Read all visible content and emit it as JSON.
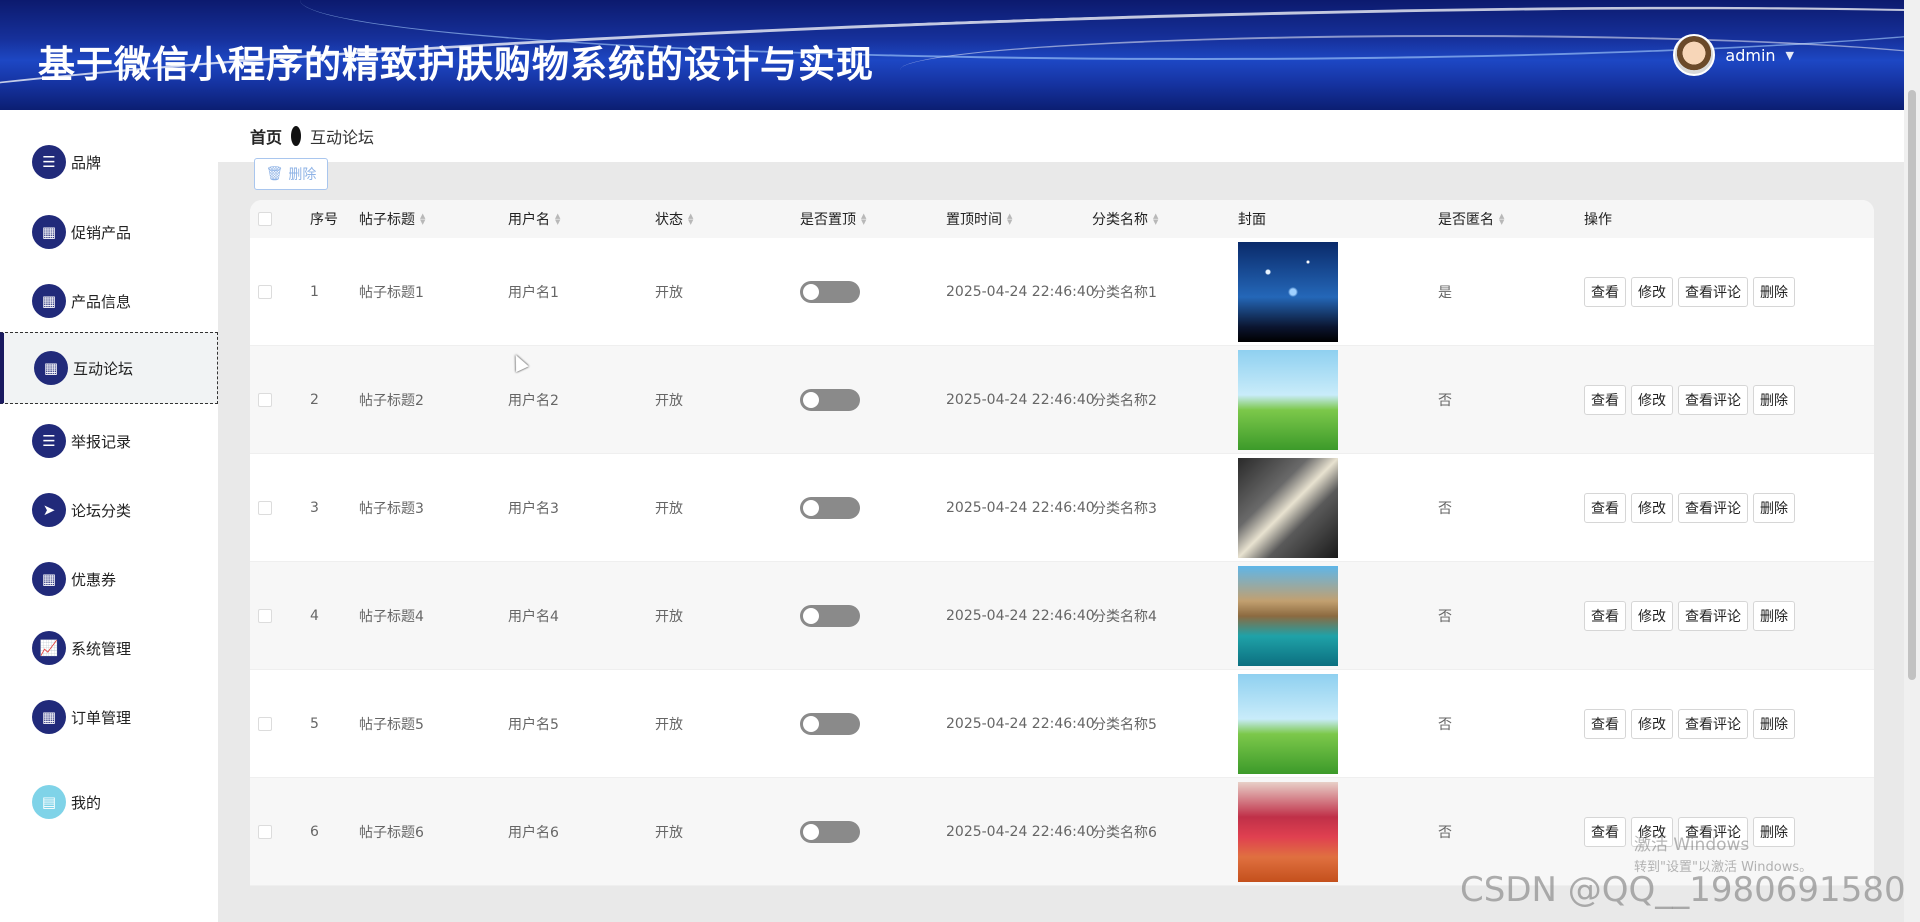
{
  "header": {
    "title": "基于微信小程序的精致护肤购物系统的设计与实现",
    "username": "admin"
  },
  "sidebar": {
    "items": [
      {
        "label": "品牌",
        "icon": "list-icon"
      },
      {
        "label": "促销产品",
        "icon": "grid-icon"
      },
      {
        "label": "产品信息",
        "icon": "grid-icon"
      },
      {
        "label": "互动论坛",
        "icon": "grid-icon"
      },
      {
        "label": "举报记录",
        "icon": "list-icon"
      },
      {
        "label": "论坛分类",
        "icon": "send-icon"
      },
      {
        "label": "优惠券",
        "icon": "grid-icon"
      },
      {
        "label": "系统管理",
        "icon": "chart-icon"
      },
      {
        "label": "订单管理",
        "icon": "grid-icon"
      },
      {
        "label": "我的",
        "icon": "card-icon"
      }
    ],
    "active_index": 3
  },
  "breadcrumb": {
    "home": "首页",
    "current": "互动论坛"
  },
  "toolbar": {
    "delete_label": "删除"
  },
  "table": {
    "headers": {
      "index": "序号",
      "title": "帖子标题",
      "username": "用户名",
      "status": "状态",
      "pinned": "是否置顶",
      "pin_time": "置顶时间",
      "category": "分类名称",
      "cover": "封面",
      "anonymous": "是否匿名",
      "actions": "操作"
    },
    "action_labels": {
      "view": "查看",
      "edit": "修改",
      "comments": "查看评论",
      "delete": "删除"
    },
    "rows": [
      {
        "index": "1",
        "title": "帖子标题1",
        "username": "用户名1",
        "status": "开放",
        "pin_time": "2025-04-24 22:46:40",
        "category": "分类名称1",
        "anonymous": "是",
        "cover": "starry-night"
      },
      {
        "index": "2",
        "title": "帖子标题2",
        "username": "用户名2",
        "status": "开放",
        "pin_time": "2025-04-24 22:46:40",
        "category": "分类名称2",
        "anonymous": "否",
        "cover": "green-field"
      },
      {
        "index": "3",
        "title": "帖子标题3",
        "username": "用户名3",
        "status": "开放",
        "pin_time": "2025-04-24 22:46:40",
        "category": "分类名称3",
        "anonymous": "否",
        "cover": "open-book"
      },
      {
        "index": "4",
        "title": "帖子标题4",
        "username": "用户名4",
        "status": "开放",
        "pin_time": "2025-04-24 22:46:40",
        "category": "分类名称4",
        "anonymous": "否",
        "cover": "sea-rock"
      },
      {
        "index": "5",
        "title": "帖子标题5",
        "username": "用户名5",
        "status": "开放",
        "pin_time": "2025-04-24 22:46:40",
        "category": "分类名称5",
        "anonymous": "否",
        "cover": "green-field"
      },
      {
        "index": "6",
        "title": "帖子标题6",
        "username": "用户名6",
        "status": "开放",
        "pin_time": "2025-04-24 22:46:40",
        "category": "分类名称6",
        "anonymous": "否",
        "cover": "autumn-path"
      }
    ]
  },
  "watermarks": {
    "activate_title": "激活 Windows",
    "activate_hint": "转到\"设置\"以激活 Windows。",
    "csdn": "CSDN @QQ__1980691580"
  }
}
